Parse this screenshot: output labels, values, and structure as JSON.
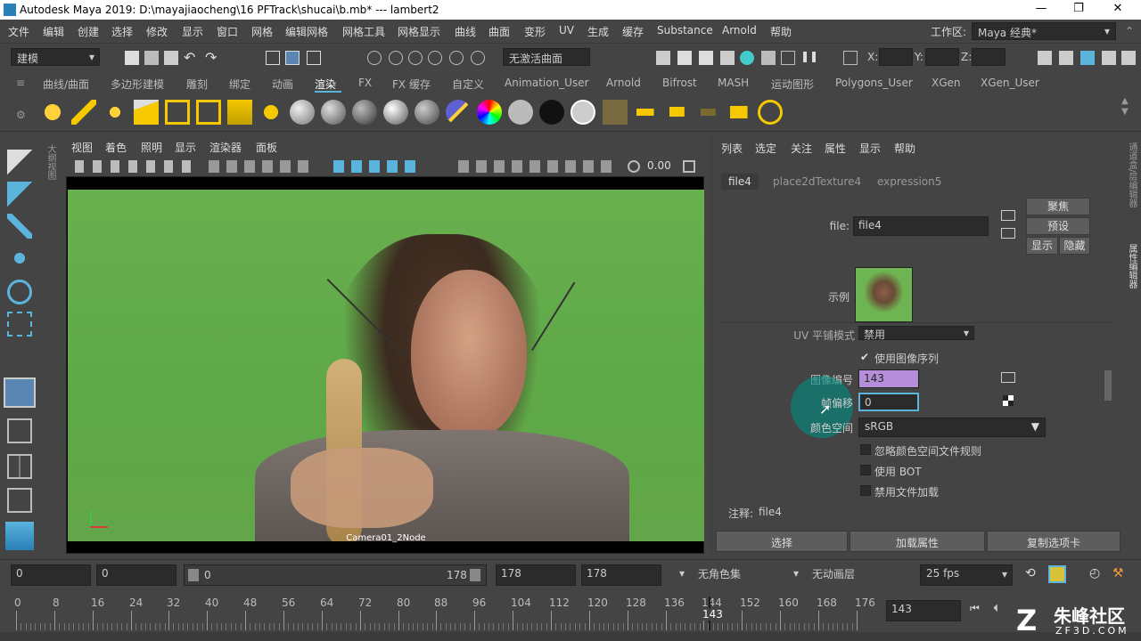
{
  "titlebar": {
    "title": "Autodesk Maya 2019: D:\\mayajiaocheng\\16 PFTrack\\shucai\\b.mb*   ---   lambert2",
    "minimize": "—",
    "restore": "❐",
    "close": "✕"
  },
  "menubar": {
    "items": [
      "文件",
      "编辑",
      "创建",
      "选择",
      "修改",
      "显示",
      "窗口",
      "网格",
      "编辑网格",
      "网格工具",
      "网格显示",
      "曲线",
      "曲面",
      "变形",
      "UV",
      "生成",
      "缓存",
      "Substance",
      "Arnold",
      "帮助"
    ],
    "workspace_label": "工作区:",
    "workspace_value": "Maya 经典*"
  },
  "statusline": {
    "mode": "建模",
    "live_surface": "无激活曲面",
    "x_label": "X:",
    "y_label": "Y:",
    "z_label": "Z:"
  },
  "shelftabs": [
    "曲线/曲面",
    "多边形建模",
    "雕刻",
    "绑定",
    "动画",
    "渲染",
    "FX",
    "FX 缓存",
    "自定义",
    "Animation_User",
    "Arnold",
    "Bifrost",
    "MASH",
    "运动图形",
    "Polygons_User",
    "XGen",
    "XGen_User"
  ],
  "active_shelf": "渲染",
  "viewport": {
    "menu": [
      "视图",
      "着色",
      "照明",
      "显示",
      "渲染器",
      "面板"
    ],
    "exposure_value": "0.00",
    "camera_label": "Camera01_2Node",
    "side_label": "大纲视图"
  },
  "attr_editor": {
    "menu": [
      "列表",
      "选定",
      "关注",
      "属性",
      "显示",
      "帮助"
    ],
    "tabs": [
      "file4",
      "place2dTexture4",
      "expression5"
    ],
    "active_tab": "file4",
    "focus_btn": "聚焦",
    "preset_btn": "预设",
    "show_btn": "显示",
    "hide_btn": "隐藏",
    "file_label": "file:",
    "file_value": "file4",
    "sample_label": "示例",
    "uv_tiling_label": "UV 平铺模式",
    "uv_tiling_value": "禁用",
    "use_sequence": "使用图像序列",
    "image_number_label": "图像编号",
    "image_number_value": "143",
    "frame_offset_label": "帧偏移",
    "frame_offset_value": "0",
    "color_space_label": "颜色空间",
    "color_space_value": "sRGB",
    "ignore_rules": "忽略颜色空间文件规则",
    "use_bot": "使用 BOT",
    "disable_loading": "禁用文件加载",
    "notes_label": "注释:",
    "notes_value": "file4",
    "select_btn": "选择",
    "load_attr_btn": "加载属性",
    "copy_tab_btn": "复制选项卡",
    "side_tabs": [
      "通道盒/层编辑器",
      "属性编辑器"
    ]
  },
  "range": {
    "start": "0",
    "anim_start": "0",
    "slider_start": "0",
    "slider_end": "178",
    "anim_end": "178",
    "end": "178",
    "character_set": "无角色集",
    "anim_layer": "无动画层",
    "fps": "25 fps"
  },
  "timeline": {
    "ticks": [
      "0",
      "8",
      "16",
      "24",
      "32",
      "40",
      "48",
      "56",
      "64",
      "72",
      "80",
      "88",
      "96",
      "104",
      "112",
      "120",
      "128",
      "136",
      "144",
      "152",
      "160",
      "168",
      "176"
    ],
    "current_frame_marker": "143",
    "current_frame": "143"
  },
  "watermark": {
    "cn": "朱峰社区",
    "en": "ZF3D.COM"
  },
  "colors": {
    "accent": "#5ab4dc",
    "image_number_bg": "#b48ed8",
    "greenscreen": "#63a84a"
  }
}
